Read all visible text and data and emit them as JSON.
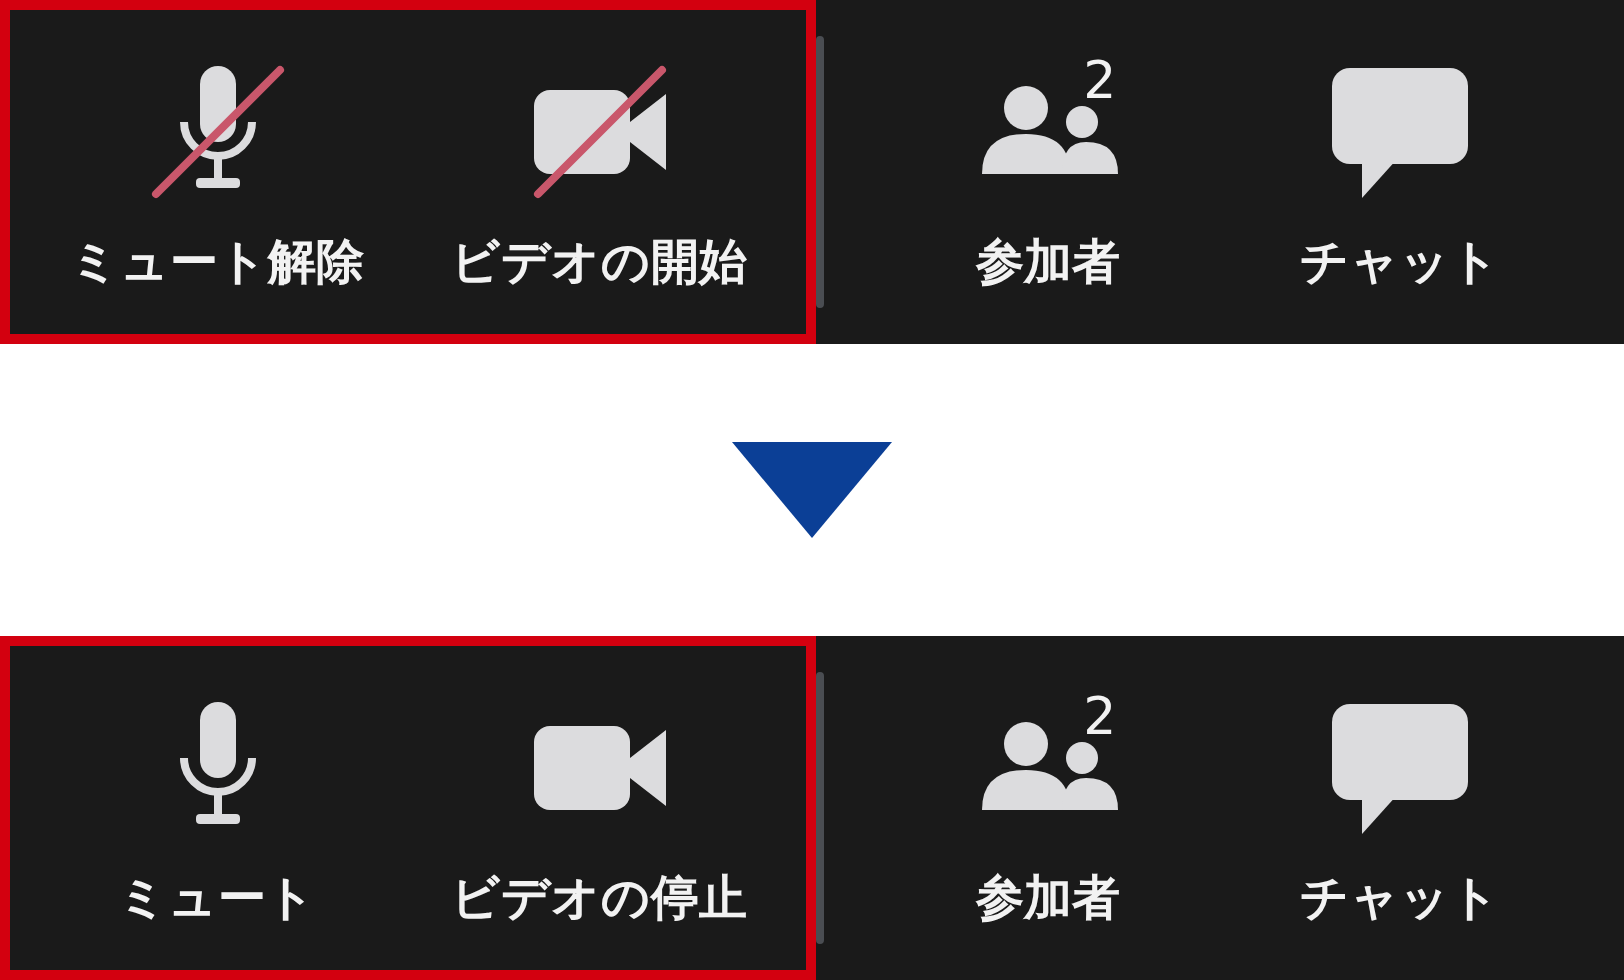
{
  "toolbars": [
    {
      "highlighted": [
        {
          "kind": "mic",
          "label": "ミュート解除",
          "muted": true
        },
        {
          "kind": "video",
          "label": "ビデオの開始",
          "muted": true
        }
      ],
      "others": [
        {
          "kind": "participants",
          "label": "参加者",
          "count": "2"
        },
        {
          "kind": "chat",
          "label": "チャット"
        }
      ]
    },
    {
      "highlighted": [
        {
          "kind": "mic",
          "label": "ミュート",
          "muted": false
        },
        {
          "kind": "video",
          "label": "ビデオの停止",
          "muted": false
        }
      ],
      "others": [
        {
          "kind": "participants",
          "label": "参加者",
          "count": "2"
        },
        {
          "kind": "chat",
          "label": "チャット"
        }
      ]
    }
  ]
}
